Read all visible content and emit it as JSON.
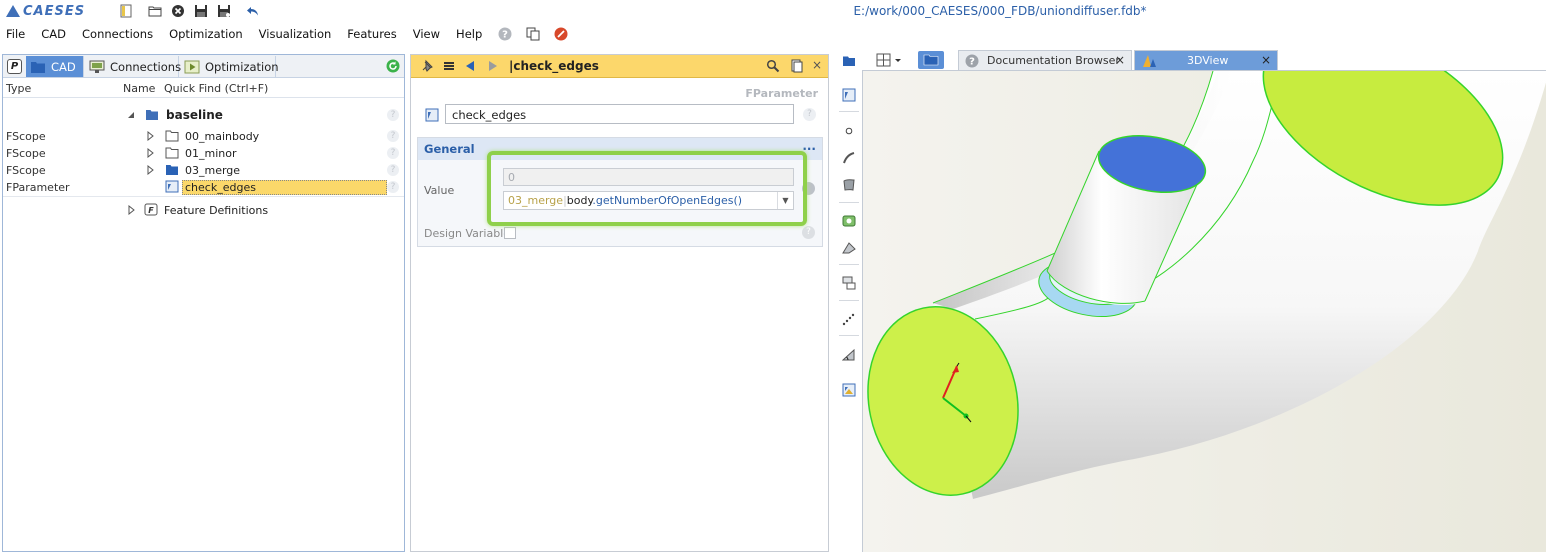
{
  "app": {
    "logo_text": "CAESES",
    "file_path": "E:/work/000_CAESES/000_FDB/uniondiffuser.fdb*"
  },
  "quick_toolbar": [
    "panel-icon",
    "folder-icon",
    "close-circle-icon",
    "save-icon",
    "save-as-icon",
    "undo-icon"
  ],
  "menu": {
    "items": [
      "File",
      "CAD",
      "Connections",
      "Optimization",
      "Visualization",
      "Features",
      "View",
      "Help"
    ],
    "trailing_icons": [
      "help-icon",
      "copy-window-icon",
      "stop-icon"
    ]
  },
  "left_panel": {
    "tabs": [
      {
        "label": "CAD",
        "icon": "folder-icon",
        "active": true
      },
      {
        "label": "Connections",
        "icon": "monitor-icon",
        "active": false
      },
      {
        "label": "Optimization",
        "icon": "play-icon",
        "active": false
      }
    ],
    "p_badge": "P",
    "columns": {
      "type": "Type",
      "name": "Name",
      "quick_find": "Quick Find (Ctrl+F)"
    },
    "tree": {
      "root": {
        "name": "baseline"
      },
      "children": [
        {
          "type": "FScope",
          "name": "00_mainbody"
        },
        {
          "type": "FScope",
          "name": "01_minor"
        },
        {
          "type": "FScope",
          "name": "03_merge"
        },
        {
          "type": "FParameter",
          "name": "check_edges",
          "selected": true
        }
      ],
      "feature_definitions": "Feature Definitions"
    },
    "help_glyph": "?"
  },
  "editor": {
    "title": "|check_edges",
    "close_glyph": "×",
    "object_type": "FParameter",
    "name_value": "check_edges",
    "section_title": "General",
    "section_menu": "...",
    "value_label": "Value",
    "value_display": "0",
    "expression": {
      "scope": "03_merge",
      "separator": "|",
      "object": "body",
      "method": ".getNumberOfOpenEdges()"
    },
    "dropdown_glyph": "▼",
    "design_variable_label": "Design Variable",
    "design_variable_checked": false,
    "help_glyph": "?"
  },
  "viewer": {
    "tabs": [
      {
        "label": "Documentation Browser",
        "active": false
      },
      {
        "label": "3DView",
        "active": true
      }
    ],
    "close_glyph": "×",
    "vertical_tools": [
      "view-icon",
      "point-icon",
      "curve-icon",
      "surface-icon",
      "green-surface-icon",
      "wedge-icon",
      "scale-icon",
      "dotted-line-icon",
      "angle-icon",
      "image-icon"
    ],
    "colors": {
      "background": "#eeede3",
      "open_edge_face": "#cdf04a",
      "top_face": "#4472d8",
      "fillet": "#a7d8f2",
      "edges": "#35d42c"
    }
  }
}
